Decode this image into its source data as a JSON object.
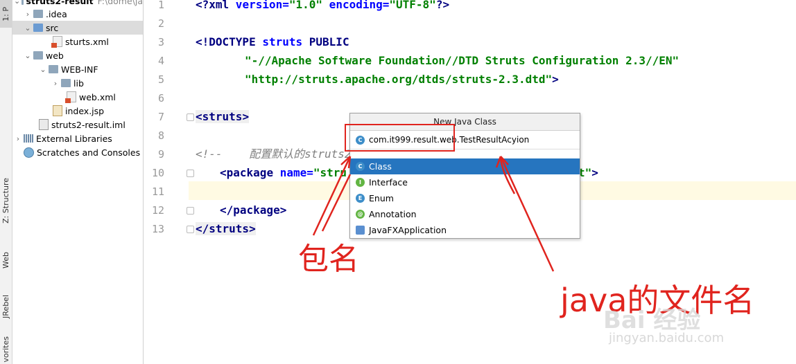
{
  "tool_strip": {
    "tabs": [
      "1: P",
      "Z: Structure",
      "Web",
      "JRebel",
      "vorites"
    ]
  },
  "project": {
    "root": {
      "name": "struts2-result",
      "path": "F:\\dome\\ja"
    },
    "items": [
      {
        "label": ".idea"
      },
      {
        "label": "src"
      },
      {
        "label": "sturts.xml"
      },
      {
        "label": "web"
      },
      {
        "label": "WEB-INF"
      },
      {
        "label": "lib"
      },
      {
        "label": "web.xml"
      },
      {
        "label": "index.jsp"
      },
      {
        "label": "struts2-result.iml"
      },
      {
        "label": "External Libraries"
      },
      {
        "label": "Scratches and Consoles"
      }
    ]
  },
  "editor": {
    "line_numbers": [
      "1",
      "2",
      "3",
      "4",
      "5",
      "6",
      "7",
      "8",
      "9",
      "10",
      "11",
      "12",
      "13"
    ],
    "line1": {
      "open": "<?",
      "tag": "xml",
      "a1": " version=",
      "v1": "\"1.0\"",
      "a2": " encoding=",
      "v2": "\"UTF-8\"",
      "close": "?>"
    },
    "line3": {
      "open": "<!",
      "tag": "DOCTYPE",
      "rest1": " struts",
      "rest2": " PUBLIC"
    },
    "line4": "\"-//Apache Software Foundation//DTD Struts Configuration 2.3//EN\"",
    "line5": {
      "str": "\"http://struts.apache.org/dtds/struts-2.3.dtd\"",
      "close": ">"
    },
    "line7": {
      "open": "<",
      "tag": "struts",
      "close": ">"
    },
    "line9": "<!--    配置默认的struts2",
    "line10": {
      "open": "<",
      "tag": "package",
      "attr": " name=",
      "str": "\"stru",
      "tail_str": "t\"",
      "close": ">"
    },
    "line12": {
      "open": "</",
      "tag": "package",
      "close": ">"
    },
    "line13": {
      "open": "</",
      "tag": "struts",
      "close": ">"
    }
  },
  "popup": {
    "title": "New Java Class",
    "input_value": "com.it999.result.web.TestResultAcyion",
    "kinds": [
      {
        "label": "Class",
        "icon": "C"
      },
      {
        "label": "Interface",
        "icon": "I"
      },
      {
        "label": "Enum",
        "icon": "E"
      },
      {
        "label": "Annotation",
        "icon": "@"
      },
      {
        "label": "JavaFXApplication",
        "icon": ""
      }
    ],
    "selected_kind": "Class"
  },
  "annotations": {
    "package_label": "包名",
    "file_label": "java的文件名",
    "color": "#e0241e"
  },
  "watermark": {
    "text": "Bai 经验",
    "url": "jingyan.baidu.com"
  }
}
